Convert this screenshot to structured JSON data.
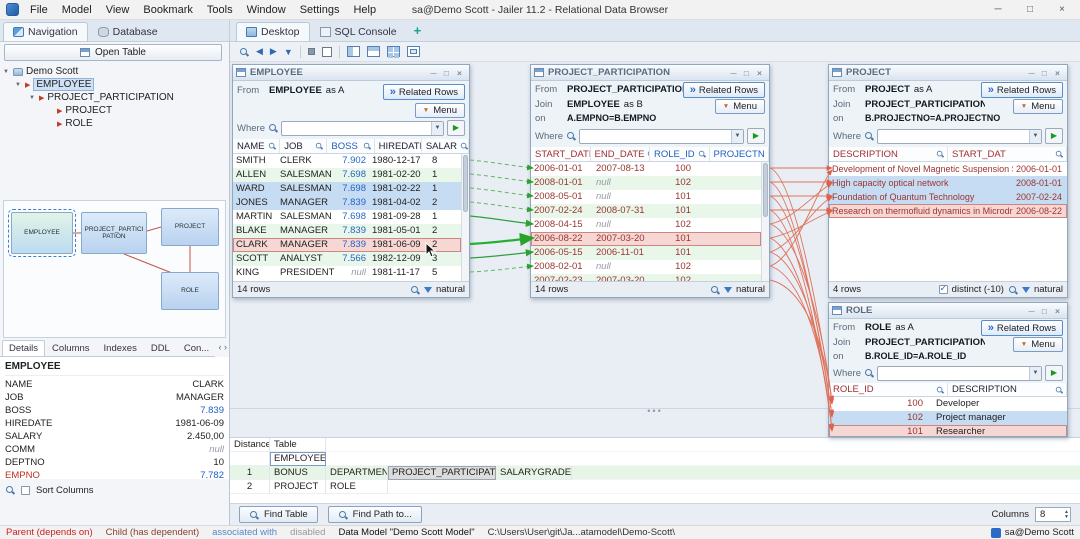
{
  "app": {
    "title": "sa@Demo Scott - Jailer 11.2 - Relational Data Browser",
    "menu": [
      "File",
      "Model",
      "View",
      "Bookmark",
      "Tools",
      "Window",
      "Settings",
      "Help"
    ]
  },
  "icons": {
    "minimize": "─",
    "maximize": "□",
    "close": "×",
    "dropdown": "▼",
    "play": "▶",
    "related": "»",
    "menu_arrow": "▼",
    "expander": "▼",
    "tree_node": "▶",
    "plus": "+",
    "back": "◀",
    "forward": "▶",
    "down": "▼",
    "tab_prev": "‹",
    "tab_next": "›",
    "dots": "•••"
  },
  "tabs": {
    "navigation": "Navigation",
    "database": "Database",
    "desktop": "Desktop",
    "sql_console": "SQL Console"
  },
  "sidebar": {
    "open_table": "Open Table",
    "tree_root": "Demo Scott",
    "tree": [
      {
        "label": "EMPLOYEE",
        "cls": "lvl1 selected"
      },
      {
        "label": "PROJECT_PARTICIPATION",
        "cls": "lvl2"
      },
      {
        "label": "PROJECT",
        "cls": "lvl3 noexp"
      },
      {
        "label": "ROLE",
        "cls": "lvl3 noexp"
      }
    ],
    "diagram": {
      "employee": "EMPLOYEE",
      "pp": "PROJECT_PARTICIPATION",
      "project": "PROJECT",
      "role": "ROLE"
    },
    "detail_tabs": [
      {
        "label": "Details",
        "cls": "active"
      },
      {
        "label": "Columns"
      },
      {
        "label": "Indexes"
      },
      {
        "label": "DDL"
      },
      {
        "label": "Con..."
      }
    ],
    "details_title": "EMPLOYEE",
    "details": [
      {
        "name": "NAME",
        "value": "CLARK"
      },
      {
        "name": "JOB",
        "value": "MANAGER"
      },
      {
        "name": "BOSS",
        "value": "7.839",
        "cls": "v-blue"
      },
      {
        "name": "HIREDATE",
        "value": "1981-06-09"
      },
      {
        "name": "SALARY",
        "value": "2.450,00"
      },
      {
        "name": "COMM",
        "value": "null"
      },
      {
        "name": "DEPTNO",
        "value": "10"
      },
      {
        "name": "EMPNO",
        "value": "7.782",
        "cls": "n-red v-blue"
      }
    ],
    "sort_columns": "Sort Columns"
  },
  "win_employee": {
    "title": "EMPLOYEE",
    "from_label": "From",
    "from_table": "EMPLOYEE",
    "from_as": "as A",
    "related_rows": "Related Rows",
    "menu": "Menu",
    "where": "Where",
    "columns": [
      {
        "label": "NAME"
      },
      {
        "label": "JOB"
      },
      {
        "label": "BOSS",
        "cls": "h-blue"
      },
      {
        "label": "HIREDATE"
      },
      {
        "label": "SALAR"
      }
    ],
    "rows": [
      {
        "cells": [
          "SMITH",
          "CLERK",
          "7.902",
          "1980-12-17",
          "8"
        ]
      },
      {
        "cells": [
          "ALLEN",
          "SALESMAN",
          "7.698",
          "1981-02-20",
          "1"
        ],
        "cls": "alt"
      },
      {
        "cells": [
          "WARD",
          "SALESMAN",
          "7.698",
          "1981-02-22",
          "1"
        ],
        "cls": "sel"
      },
      {
        "cells": [
          "JONES",
          "MANAGER",
          "7.839",
          "1981-04-02",
          "2"
        ],
        "cls": "sel"
      },
      {
        "cells": [
          "MARTIN",
          "SALESMAN",
          "7.698",
          "1981-09-28",
          "1"
        ]
      },
      {
        "cells": [
          "BLAKE",
          "MANAGER",
          "7.839",
          "1981-05-01",
          "2"
        ],
        "cls": "alt"
      },
      {
        "cells": [
          "CLARK",
          "MANAGER",
          "7.839",
          "1981-06-09",
          "2"
        ],
        "cls": "cur"
      },
      {
        "cells": [
          "SCOTT",
          "ANALYST",
          "7.566",
          "1982-12-09",
          "3"
        ],
        "cls": "alt"
      },
      {
        "cells": [
          "KING",
          "PRESIDENT",
          "null",
          "1981-11-17",
          "5"
        ]
      }
    ],
    "row_count": "14 rows",
    "natural": "natural"
  },
  "win_pp": {
    "title": "PROJECT_PARTICIPATION",
    "from_label": "From",
    "from_table": "PROJECT_PARTICIPATION",
    "from_suffix": "..",
    "join_label": "Join",
    "join_table": "EMPLOYEE",
    "join_as": "as B",
    "on_label": "on",
    "on_value": "A.EMPNO=B.EMPNO",
    "related_rows": "Related Rows",
    "menu": "Menu",
    "where": "Where",
    "columns": [
      {
        "label": "START_DATE",
        "cls": "h-red"
      },
      {
        "label": "END_DATE",
        "cls": "h-red"
      },
      {
        "label": "ROLE_ID",
        "cls": "h-blue"
      },
      {
        "label": "PROJECTN",
        "cls": "h-blue"
      }
    ],
    "rows": [
      {
        "cells": [
          "2006-01-01",
          "2007-08-13",
          "100",
          ""
        ]
      },
      {
        "cells": [
          "2008-01-01",
          "null",
          "102",
          ""
        ],
        "cls": "alt"
      },
      {
        "cells": [
          "2008-05-01",
          "null",
          "101",
          ""
        ]
      },
      {
        "cells": [
          "2007-02-24",
          "2008-07-31",
          "101",
          ""
        ],
        "cls": "alt"
      },
      {
        "cells": [
          "2008-04-15",
          "null",
          "102",
          ""
        ]
      },
      {
        "cells": [
          "2006-08-22",
          "2007-03-20",
          "101",
          ""
        ],
        "cls": "cur"
      },
      {
        "cells": [
          "2006-05-15",
          "2006-11-01",
          "101",
          ""
        ],
        "cls": "alt"
      },
      {
        "cells": [
          "2008-02-01",
          "null",
          "102",
          ""
        ]
      },
      {
        "cells": [
          "2007-02-23",
          "2007-03-20",
          "102",
          ""
        ],
        "cls": "alt"
      }
    ],
    "row_count": "14 rows",
    "natural": "natural"
  },
  "win_project": {
    "title": "PROJECT",
    "from_label": "From",
    "from_table": "PROJECT",
    "from_as": "as A",
    "join_label": "Join",
    "join_table": "PROJECT_PARTICIPATION",
    "on_label": "on",
    "on_value": "B.PROJECTNO=A.PROJECTNO",
    "related_rows": "Related Rows",
    "menu": "Menu",
    "where": "Where",
    "columns": [
      {
        "label": "DESCRIPTION",
        "cls": "h-red"
      },
      {
        "label": "START_DAT",
        "cls": "h-red"
      }
    ],
    "rows": [
      {
        "cells": [
          "Development of Novel Magnetic Suspension System",
          "2006-01-01"
        ]
      },
      {
        "cells": [
          "High capacity optical network",
          "2008-01-01"
        ],
        "cls": "sel"
      },
      {
        "cells": [
          "Foundation of Quantum Technology",
          "2007-02-24"
        ],
        "cls": "sel"
      },
      {
        "cells": [
          "Research on thermofluid dynamics in Microdroplets",
          "2006-08-22"
        ],
        "cls": "cur"
      }
    ],
    "row_count": "4 rows",
    "distinct": "distinct (-10)",
    "natural": "natural"
  },
  "win_role": {
    "title": "ROLE",
    "from_label": "From",
    "from_table": "ROLE",
    "from_as": "as A",
    "join_label": "Join",
    "join_table": "PROJECT_PARTICIPATION",
    "on_label": "on",
    "on_value": "B.ROLE_ID=A.ROLE_ID",
    "related_rows": "Related Rows",
    "menu": "Menu",
    "where": "Where",
    "columns": [
      {
        "label": "ROLE_ID",
        "cls": "h-red"
      },
      {
        "label": "DESCRIPTION"
      }
    ],
    "rows": [
      {
        "cells": [
          "100",
          "Developer"
        ]
      },
      {
        "cells": [
          "102",
          "Project manager"
        ],
        "cls": "sel"
      },
      {
        "cells": [
          "101",
          "Researcher"
        ],
        "cls": "cur"
      }
    ]
  },
  "bottom": {
    "header_distance": "Distance",
    "header_table": "Table",
    "r0_distance": "",
    "r0_cells": [
      {
        "t": "EMPLOYEE",
        "cls": "boxed"
      }
    ],
    "r1_distance": "1",
    "r1_cells": [
      {
        "t": "BONUS"
      },
      {
        "t": "DEPARTMENT"
      },
      {
        "t": "PROJECT_PARTICIPATION",
        "cls": "shaded"
      },
      {
        "t": "SALARYGRADE"
      }
    ],
    "r2_distance": "2",
    "r2_cells": [
      {
        "t": "PROJECT"
      },
      {
        "t": "ROLE"
      }
    ],
    "find_table": "Find Table",
    "find_path": "Find Path to...",
    "columns_label": "Columns",
    "columns_value": "8"
  },
  "statusbar": {
    "parent": "Parent (depends on)",
    "child": "Child (has dependent)",
    "associated": "associated with",
    "disabled": "disabled",
    "model": "Data Model \"Demo Scott Model\"",
    "path": "C:\\Users\\User\\git\\Ja...atamodel\\Demo-Scott\\",
    "user": "sa@Demo Scott"
  }
}
